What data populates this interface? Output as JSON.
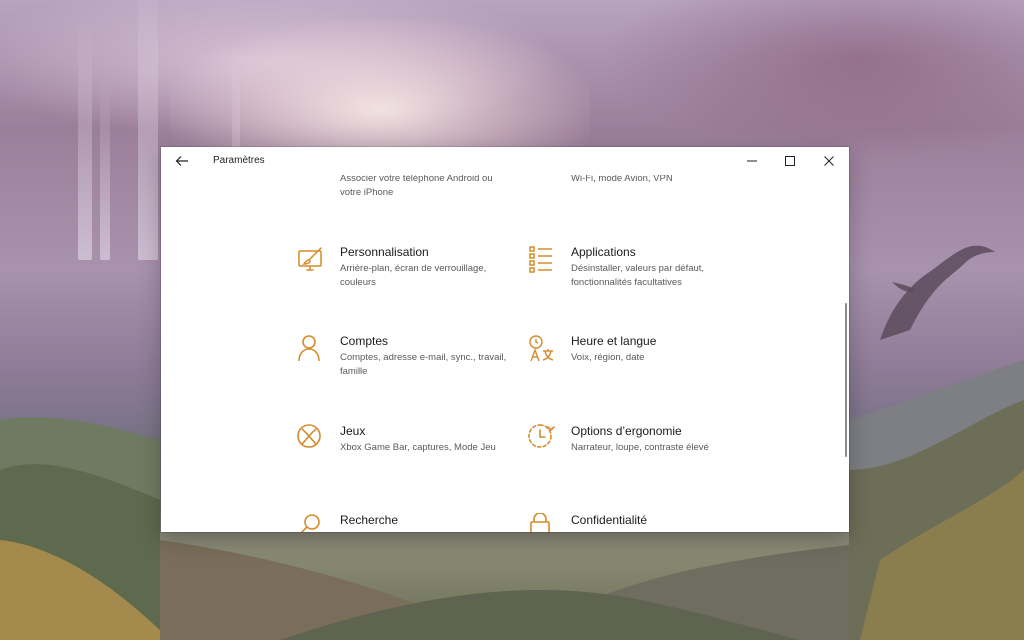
{
  "window": {
    "title": "Paramètres",
    "accent": "#d68a2a"
  },
  "tiles": [
    {
      "name": "",
      "desc": "Associer votre téléphone Android ou votre iPhone",
      "icon": "phone-icon"
    },
    {
      "name": "",
      "desc": "Wi-Fi, mode Avion, VPN",
      "icon": "globe-icon"
    },
    {
      "name": "Personnalisation",
      "desc": "Arrière-plan, écran de verrouillage, couleurs",
      "icon": "paint-brush-icon"
    },
    {
      "name": "Applications",
      "desc": "Désinstaller, valeurs par défaut, fonctionnalités facultatives",
      "icon": "apps-list-icon"
    },
    {
      "name": "Comptes",
      "desc": "Comptes, adresse e-mail, sync., travail, famille",
      "icon": "person-icon"
    },
    {
      "name": "Heure et langue",
      "desc": "Voix, région, date",
      "icon": "time-language-icon"
    },
    {
      "name": "Jeux",
      "desc": "Xbox Game Bar, captures, Mode Jeu",
      "icon": "xbox-icon"
    },
    {
      "name": "Options d’ergonomie",
      "desc": "Narrateur, loupe, contraste élevé",
      "icon": "ease-of-access-icon"
    },
    {
      "name": "Recherche",
      "desc": "",
      "icon": "search-icon"
    },
    {
      "name": "Confidentialité",
      "desc": "",
      "icon": "lock-icon"
    }
  ]
}
